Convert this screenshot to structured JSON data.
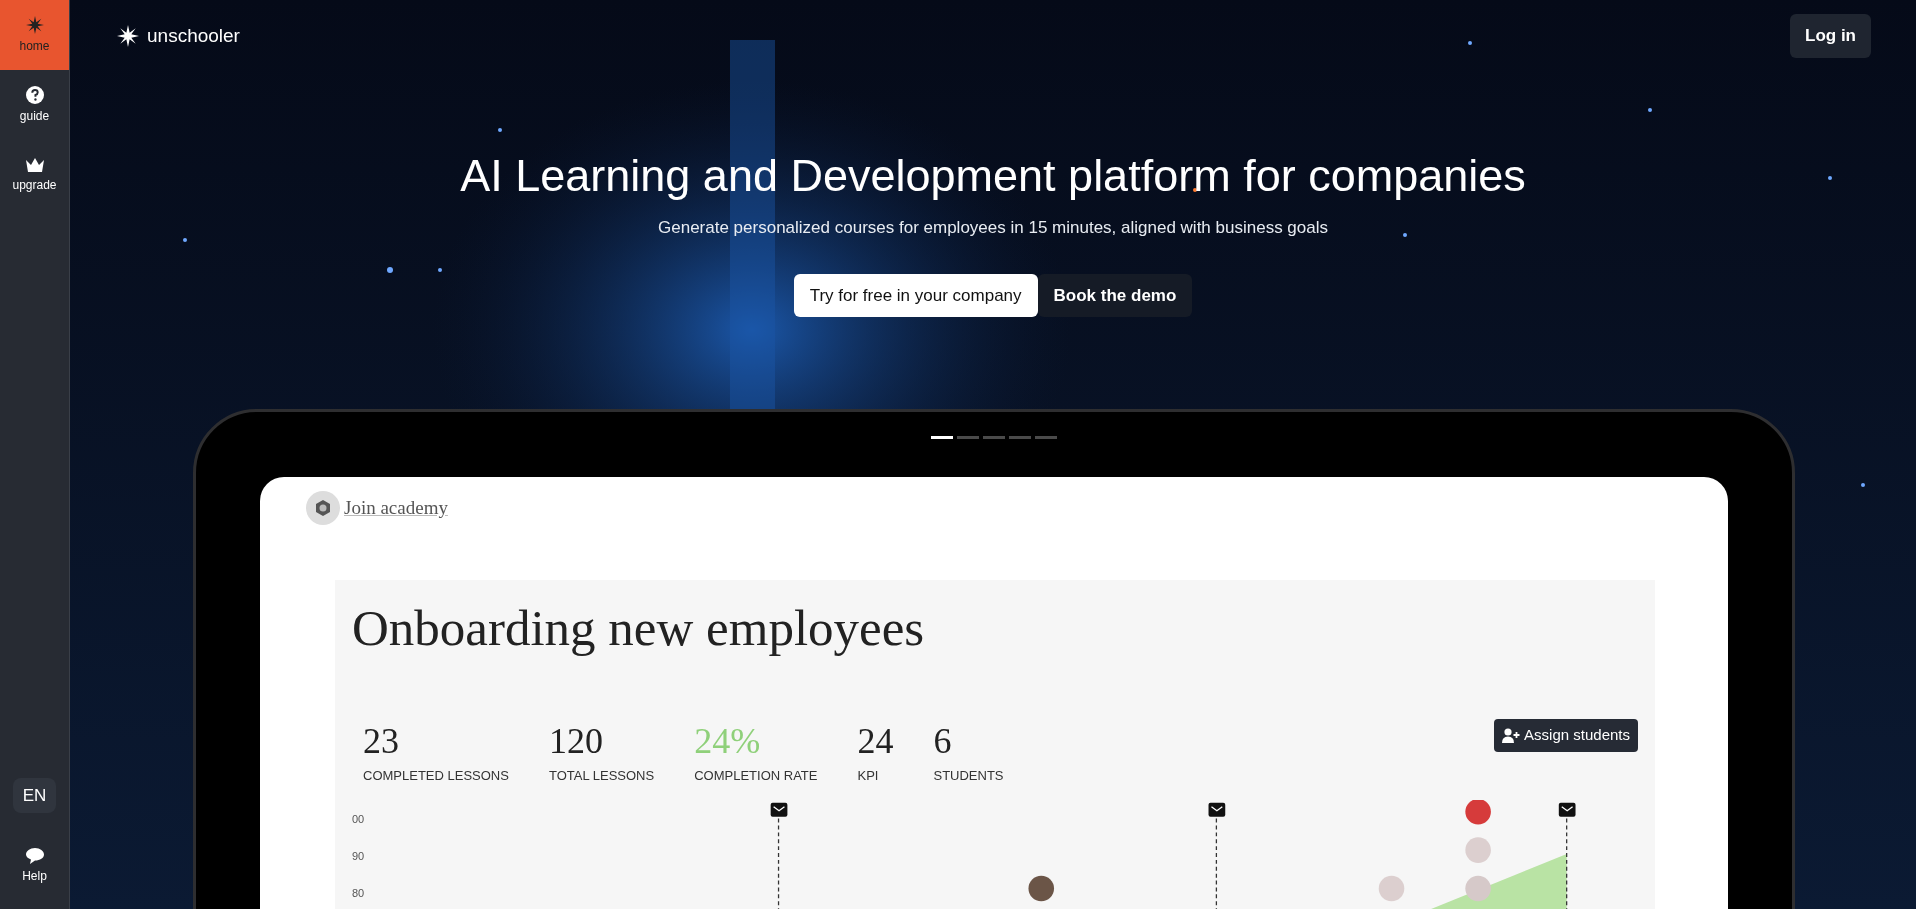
{
  "sidebar": {
    "items": [
      {
        "label": "home",
        "kind": "star",
        "selected": true
      },
      {
        "label": "guide",
        "kind": "question",
        "selected": false
      },
      {
        "label": "upgrade",
        "kind": "crown",
        "selected": false
      }
    ],
    "language": "EN",
    "help": "Help"
  },
  "header": {
    "logo": "unschooler",
    "login": "Log in"
  },
  "hero": {
    "title": "AI Learning and Development platform for companies",
    "subtitle": "Generate personalized courses for employees in 15 minutes, aligned with business goals",
    "buttons": [
      {
        "label": "Try for free in your company",
        "kind": "primary"
      },
      {
        "label": "Book the demo",
        "kind": "secondary"
      }
    ]
  },
  "carousel": {
    "slides": [
      {
        "selected": true
      },
      {
        "selected": false
      },
      {
        "selected": false
      },
      {
        "selected": false
      },
      {
        "selected": false
      }
    ]
  },
  "preview": {
    "brand": "Join academy",
    "heading": "Onboarding new employees",
    "stats": [
      {
        "value": "23",
        "label": "COMPLETED LESSONS",
        "highlight": false
      },
      {
        "value": "120",
        "label": "TOTAL LESSONS",
        "highlight": false
      },
      {
        "value": "24%",
        "label": "COMPLETION RATE",
        "highlight": true
      },
      {
        "value": "24",
        "label": "KPI",
        "highlight": false
      },
      {
        "value": "6",
        "label": "STUDENTS",
        "highlight": false
      }
    ],
    "assign_button": "Assign students",
    "chart": {
      "y_labels": [
        "00",
        "90",
        "80"
      ]
    }
  }
}
